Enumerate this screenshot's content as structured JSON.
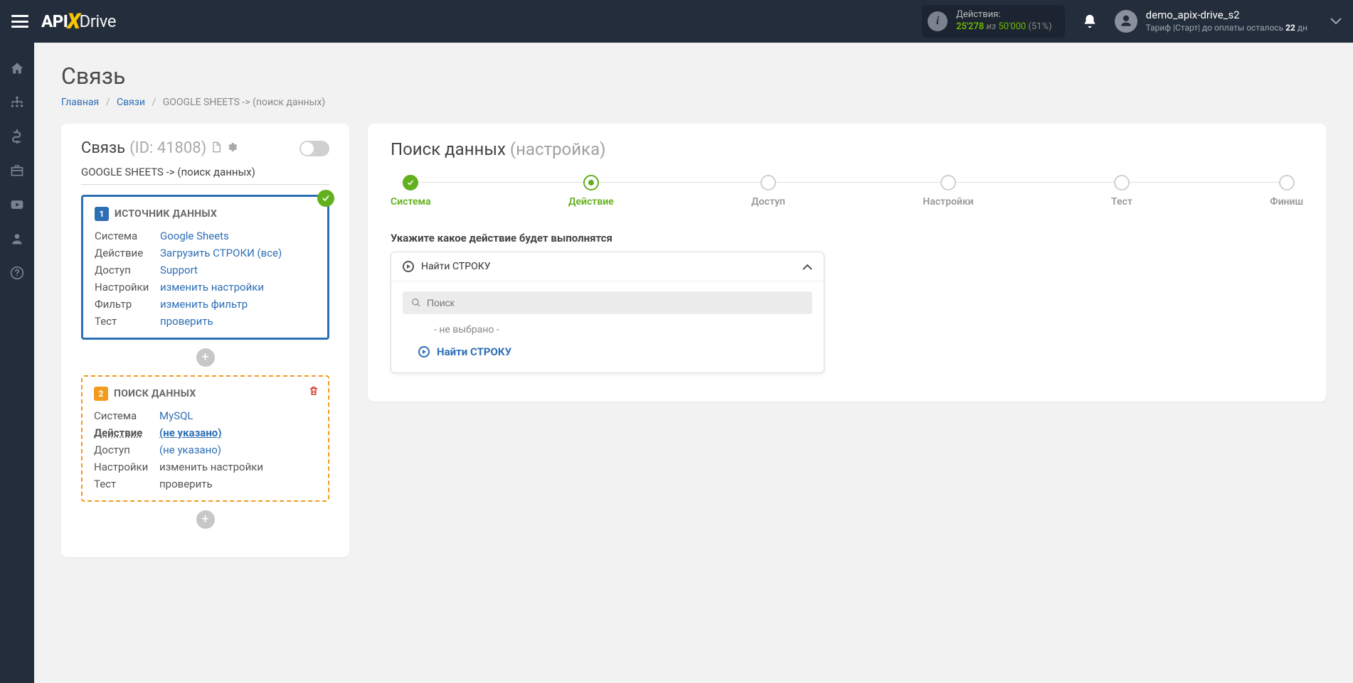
{
  "topbar": {
    "actions_label": "Действия:",
    "actions_used": "25'278",
    "actions_of": "из",
    "actions_total": "50'000",
    "actions_pct": "(51%)",
    "user_name": "demo_apix-drive_s2",
    "tariff_prefix": "Тариф |Старт| до оплаты осталось ",
    "tariff_days": "22",
    "tariff_suffix": " дн"
  },
  "page": {
    "title": "Связь",
    "bc_home": "Главная",
    "bc_links": "Связи",
    "bc_current": "GOOGLE SHEETS -> (поиск данных)"
  },
  "left": {
    "title": "Связь",
    "id": "(ID: 41808)",
    "conn_name": "GOOGLE SHEETS -> (поиск данных)",
    "source": {
      "heading": "ИСТОЧНИК ДАННЫХ",
      "rows": {
        "system_l": "Система",
        "system_v": "Google Sheets",
        "action_l": "Действие",
        "action_v": "Загрузить СТРОКИ (все)",
        "access_l": "Доступ",
        "access_v": "Support",
        "settings_l": "Настройки",
        "settings_v": "изменить настройки",
        "filter_l": "Фильтр",
        "filter_v": "изменить фильтр",
        "test_l": "Тест",
        "test_v": "проверить"
      }
    },
    "search": {
      "heading": "ПОИСК ДАННЫХ",
      "rows": {
        "system_l": "Система",
        "system_v": "MySQL",
        "action_l": "Действие",
        "action_v": "(не указано)",
        "access_l": "Доступ",
        "access_v": "(не указано)",
        "settings_l": "Настройки",
        "settings_v": "изменить настройки",
        "test_l": "Тест",
        "test_v": "проверить"
      }
    }
  },
  "right": {
    "title_main": "Поиск данных ",
    "title_sub": "(настройка)",
    "steps": {
      "s1": "Система",
      "s2": "Действие",
      "s3": "Доступ",
      "s4": "Настройки",
      "s5": "Тест",
      "s6": "Финиш"
    },
    "field_label": "Укажите какое действие будет выполнятся",
    "selected": "Найти СТРОКУ",
    "search_ph": "Поиск",
    "none": "- не выбрано -",
    "option": "Найти СТРОКУ"
  }
}
